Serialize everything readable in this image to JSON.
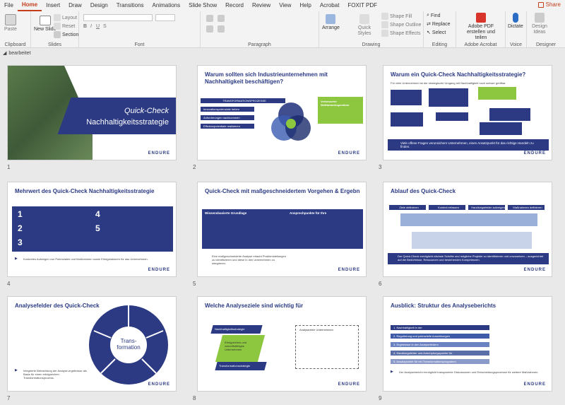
{
  "tabs": [
    "File",
    "Home",
    "Insert",
    "Draw",
    "Design",
    "Transitions",
    "Animations",
    "Slide Show",
    "Record",
    "Review",
    "View",
    "Help",
    "Acrobat",
    "FOXIT PDF"
  ],
  "active_tab": "Home",
  "share_label": "Share",
  "ribbon": {
    "clipboard": {
      "label": "Clipboard",
      "paste": "Paste"
    },
    "slides": {
      "label": "Slides",
      "new_slide": "New Slide",
      "layout": "Layout",
      "reset": "Reset",
      "section": "Section"
    },
    "font": {
      "label": "Font"
    },
    "paragraph": {
      "label": "Paragraph"
    },
    "drawing": {
      "label": "Drawing",
      "arrange": "Arrange",
      "quick_styles": "Quick Styles",
      "shape_fill": "Shape Fill",
      "shape_outline": "Shape Outline",
      "shape_effects": "Shape Effects"
    },
    "editing": {
      "label": "Editing",
      "find": "Find",
      "replace": "Replace",
      "select": "Select"
    },
    "adobe": {
      "label": "Adobe Acrobat",
      "btn": "Adobe PDF erstellen und teilen"
    },
    "voice": {
      "label": "Voice",
      "dictate": "Dictate"
    },
    "designer": {
      "label": "Designer",
      "design_ideas": "Design Ideas"
    }
  },
  "section_name": "bearbeitet",
  "brand": "ENDURE",
  "slides": [
    {
      "num": "1",
      "title": "Quick-Check",
      "subtitle": "Nachhaltigkeitsstrategie"
    },
    {
      "num": "2",
      "title": "Warum sollten sich Industrieunternehmen mit Nachhaltigkeit beschäftigen?",
      "bar": "TRANSFORMATIONSPROZESSE",
      "items": [
        "Innovationspotenziale heben",
        "Anforderungen nachkommen",
        "Effizienzpotentiale realisieren"
      ],
      "green": "Verbesserte Wettbewerbsposition"
    },
    {
      "num": "3",
      "title": "Warum ein Quick-Check Nachhaltigkeitsstrategie?",
      "intro": "Für viele Unternehmen ist der strategische Umgang mit Nachhaltigkeit noch schwer greifbar.",
      "bottom": "Viele offene Fragen verunsichern Unternehmen, einen Ansatzpunkt für das richtige Handeln zu finden."
    },
    {
      "num": "4",
      "title": "Mehrwert des Quick-Check Nachhaltigkeitsstrategie",
      "points": [
        "1",
        "2",
        "3",
        "4",
        "5"
      ],
      "bottom": "Konkretes Aufzeigen von Potenzialen und Maßnahmen sowie Erfolgsfaktoren für das Unternehmen."
    },
    {
      "num": "5",
      "title": "Quick-Check mit maßgeschneidertem Vorgehen & Ergebnissen für",
      "left": "Wissensbasierte Grundlage",
      "right": "Ansprechpunkte für Ihre",
      "bottom": "Eine maßgeschneiderte Analyse erlaubt Problemstellungen zu identifizieren und diese in den Unternehmen zu integrieren."
    },
    {
      "num": "6",
      "title": "Ablauf des Quick-Check",
      "steps": [
        "Ziele definieren",
        "Kontext erfassen",
        "Handlungsfelder aufzeigen",
        "Maßnahmen definieren"
      ],
      "bottom": "Der Quick-Check ermöglicht nächste Schritte und mögliche Projekte zu identifizieren und umzusetzen – ausgerichtet auf die Bedürfnisse, Ressourcen und bestehenden Kompetenzen."
    },
    {
      "num": "7",
      "title": "Analysefelder des Quick-Check",
      "center": "Trans-formation",
      "bottom": "Integrierte Betrachtung der Analyse-ergebnisse als Basis für einen erfolgreichen Transformationsprozess."
    },
    {
      "num": "8",
      "title": "Welche Analyseziele sind wichtig für",
      "box": "Analyseziele Unternehmen",
      "labels": [
        "Nachhaltigkeitsstrategie",
        "Erfolgreiches und zukunftsfähiges Unternehmen",
        "Transformationsstrategie"
      ]
    },
    {
      "num": "9",
      "title": "Ausblick: Struktur des Analyseberichts",
      "rows": [
        "1. Nachhaltigkeit in der",
        "2. Regulierung und potenzielle Auswirkungen",
        "3. Ergebnisse in den Analysefeldern",
        "4. Handlungsfelder und Anknüpfungspunkte für",
        "5. Ansatzpunkte für ein Transformationsprogramm"
      ],
      "bottom": "Der Analysebericht ermöglicht transparente Diskussionen und Entscheidungsprozesse für weitere Maßnahmen."
    }
  ]
}
